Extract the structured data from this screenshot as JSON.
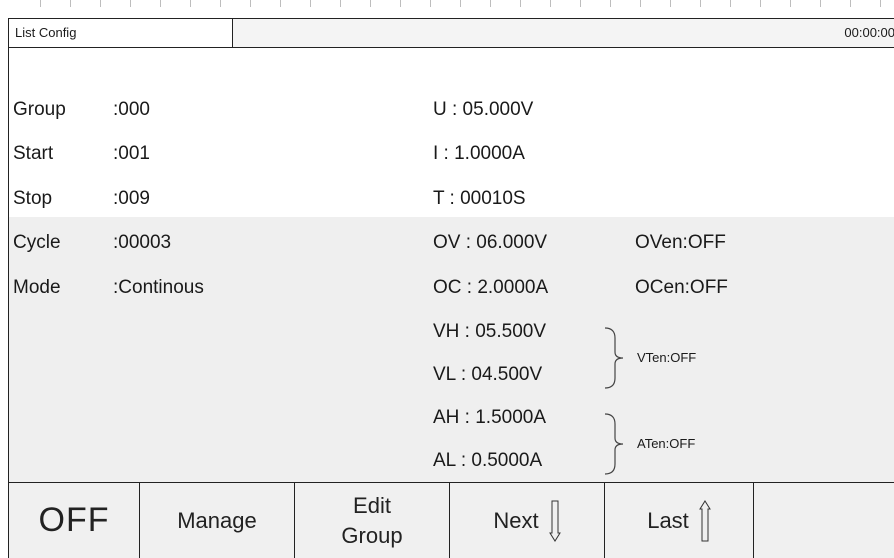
{
  "titlebar": {
    "tab_label": "List Config",
    "clock": "00:00:00"
  },
  "left_params": [
    {
      "label": "Group",
      "value": ":000"
    },
    {
      "label": "Start",
      "value": ":001"
    },
    {
      "label": "Stop",
      "value": ":009"
    },
    {
      "label": "Cycle",
      "value": ":00003"
    },
    {
      "label": "Mode",
      "value": ":Continous"
    }
  ],
  "right_params": {
    "u": "U  :  05.000V",
    "i": "I  :  1.0000A",
    "t": "T :     00010S",
    "ov": "OV :  06.000V",
    "oc": "OC : 2.0000A",
    "vh": "VH : 05.500V",
    "vl": "VL  : 04.500V",
    "ah": "AH : 1.5000A",
    "al": "AL  : 0.5000A"
  },
  "enables": {
    "oven": "OVen:OFF",
    "ocen": "OCen:OFF",
    "vten": "VTen:OFF",
    "aten": "ATen:OFF"
  },
  "function_keys": {
    "output": "OFF",
    "manage": "Manage",
    "edit_line1": "Edit",
    "edit_line2": "Group",
    "next": "Next",
    "last": "Last"
  },
  "icons": {
    "next": "down-arrow-icon",
    "last": "up-arrow-icon"
  }
}
